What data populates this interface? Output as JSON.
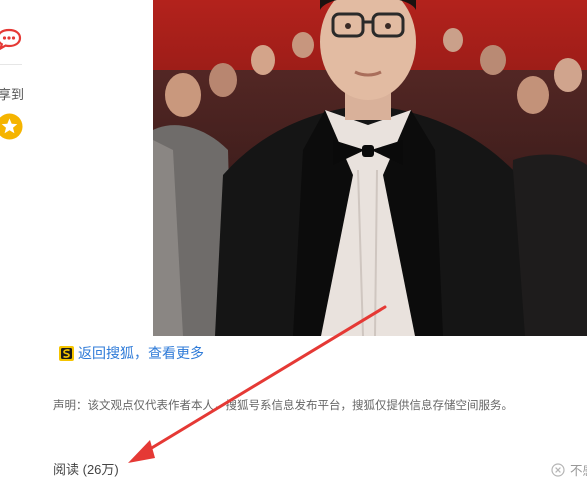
{
  "share_rail": {
    "comment_icon": "chat-bubble-icon",
    "share_label": "享到",
    "favorite_icon": "star-icon"
  },
  "photo": {
    "subject": "man in tuxedo and bow tie at red carpet event"
  },
  "back_link": {
    "icon": "sohu-logo-icon",
    "label": "返回搜狐，查看更多"
  },
  "disclaimer": "声明：该文观点仅代表作者本人，搜狐号系信息发布平台，搜狐仅提供信息存储空间服务。",
  "stats": {
    "read_count": "阅读 (26万)"
  },
  "report": {
    "icon": "close-circle-icon",
    "label": "不感"
  },
  "colors": {
    "link": "#2f7bd8",
    "annotation_arrow": "#e53935",
    "comment_icon": "#e53935",
    "star_icon": "#f5b400"
  }
}
